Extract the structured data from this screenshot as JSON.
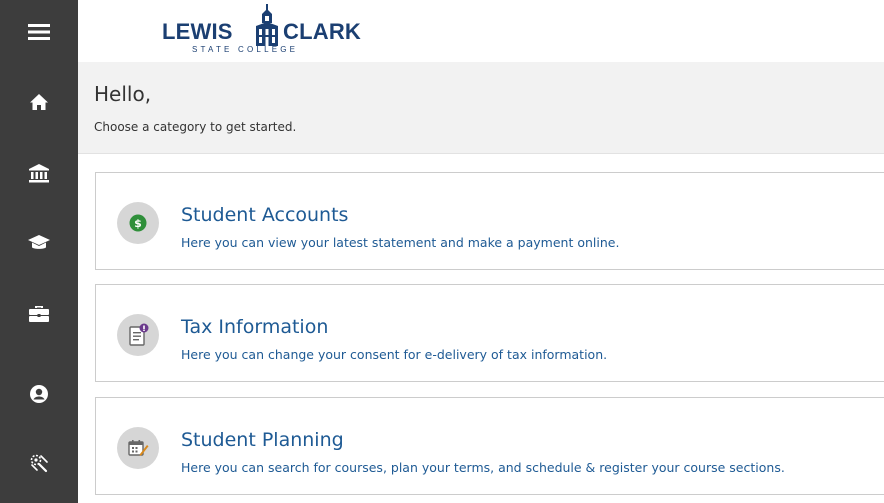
{
  "colors": {
    "sidebar": "#3d3d3d",
    "link": "#1e5a94",
    "logo": "#1b3f72",
    "greeting_bg": "#f2f2f2"
  },
  "sidebar": {
    "items": [
      {
        "icon": "hamburger-menu-icon"
      },
      {
        "icon": "home-icon"
      },
      {
        "icon": "bank-icon"
      },
      {
        "icon": "graduation-cap-icon"
      },
      {
        "icon": "briefcase-icon"
      },
      {
        "icon": "user-circle-icon"
      },
      {
        "icon": "tools-icon"
      }
    ]
  },
  "logo": {
    "word_left": "LEWIS",
    "word_right": "CLARK",
    "subtitle": "STATE COLLEGE"
  },
  "greeting": {
    "title": "Hello,",
    "subtitle": "Choose a category to get started."
  },
  "cards": [
    {
      "title": "Student Accounts",
      "description": "Here you can view your latest statement and make a payment online.",
      "icon": "dollar-coin-icon"
    },
    {
      "title": "Tax Information",
      "description": "Here you can change your consent for e-delivery of tax information.",
      "icon": "tax-document-icon"
    },
    {
      "title": "Student Planning",
      "description": "Here you can search for courses, plan your terms, and schedule & register your course sections.",
      "icon": "calendar-pencil-icon"
    }
  ]
}
